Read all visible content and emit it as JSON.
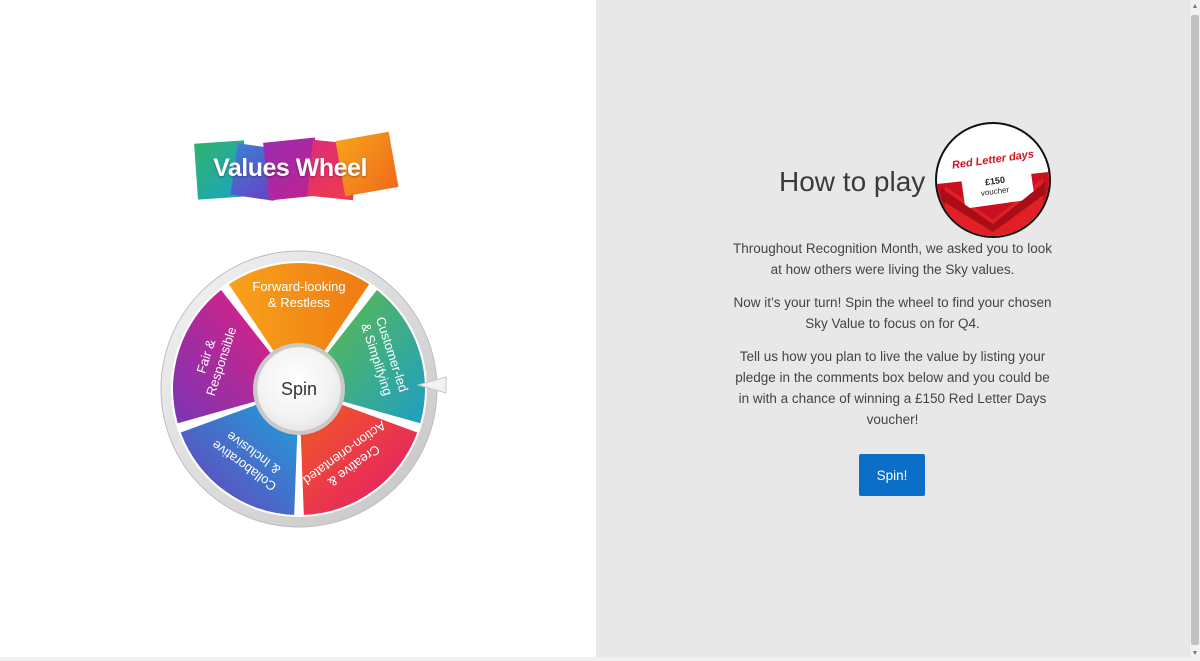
{
  "logo": {
    "text": "Values Wheel"
  },
  "wheel": {
    "segments": [
      {
        "line1": "Forward-looking",
        "line2": "& Restless",
        "color": "#f28c1b"
      },
      {
        "line1": "Customer-led",
        "line2": "& Simplifying",
        "color": "#2aa86a"
      },
      {
        "line1": "Creative &",
        "line2": "Action-orientated",
        "color": "#ec2e4d"
      },
      {
        "line1": "Collaborative",
        "line2": "& Inclusive",
        "color": "#2f7fd3"
      },
      {
        "line1": "Fair &",
        "line2": "Responsible",
        "color": "#b5198f"
      }
    ],
    "hub_label": "Spin"
  },
  "how_to": {
    "title": "How to play",
    "badge": {
      "brand": "Red Letter days",
      "amount": "£150",
      "kind": "voucher"
    },
    "paragraphs": [
      "Throughout Recognition Month, we asked you to look at how others were living the Sky values.",
      "Now it’s your turn! Spin the wheel to find your chosen Sky Value to focus on for Q4.",
      "Tell us how you plan to live the value by listing your pledge in the comments box below and you could be in with a chance of winning a £150 Red Letter Days voucher!"
    ],
    "button_label": "Spin!"
  }
}
